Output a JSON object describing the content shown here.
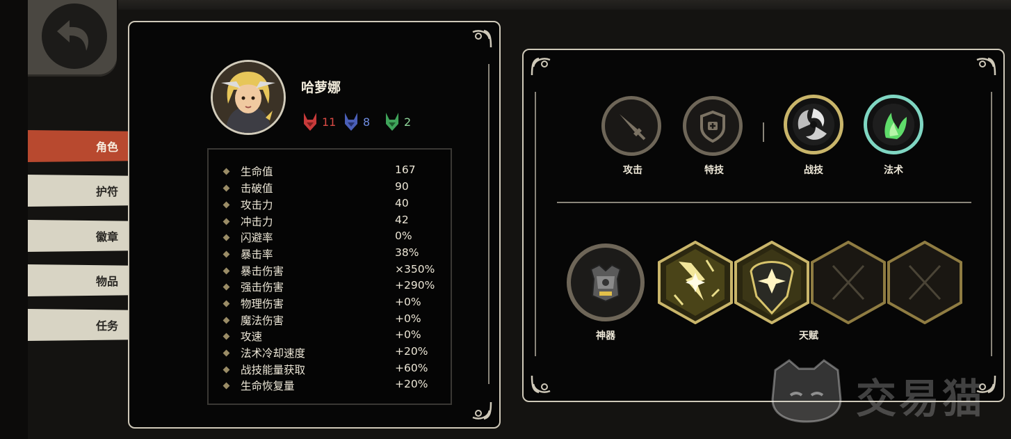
{
  "hero": {
    "name": "哈萝娜",
    "factions": [
      {
        "icon": "red-beast-icon",
        "value": "11",
        "color": "#d94a44"
      },
      {
        "icon": "blue-beast-icon",
        "value": "8",
        "color": "#6f8ce0"
      },
      {
        "icon": "green-beast-icon",
        "value": "2",
        "color": "#6fcf7a"
      }
    ]
  },
  "tabs": [
    {
      "label": "角色",
      "active": true
    },
    {
      "label": "护符",
      "active": false
    },
    {
      "label": "徽章",
      "active": false
    },
    {
      "label": "物品",
      "active": false
    },
    {
      "label": "任务",
      "active": false
    }
  ],
  "stats": [
    {
      "name": "生命值",
      "value": "167"
    },
    {
      "name": "击破值",
      "value": "90"
    },
    {
      "name": "攻击力",
      "value": "40"
    },
    {
      "name": "冲击力",
      "value": "42"
    },
    {
      "name": "闪避率",
      "value": "0%"
    },
    {
      "name": "暴击率",
      "value": "38%"
    },
    {
      "name": "暴击伤害",
      "value": "×350%"
    },
    {
      "name": "强击伤害",
      "value": "+290%"
    },
    {
      "name": "物理伤害",
      "value": "+0%"
    },
    {
      "name": "魔法伤害",
      "value": "+0%"
    },
    {
      "name": "攻速",
      "value": "+0%"
    },
    {
      "name": "法术冷却速度",
      "value": "+20%"
    },
    {
      "name": "战技能量获取",
      "value": "+60%"
    },
    {
      "name": "生命恢复量",
      "value": "+20%"
    }
  ],
  "skills": [
    {
      "label": "攻击",
      "icon": "sword-icon"
    },
    {
      "label": "特技",
      "icon": "shield-cross-icon"
    },
    {
      "label": "战技",
      "icon": "swirl-blades-icon"
    },
    {
      "label": "法术",
      "icon": "green-flame-icon"
    }
  ],
  "equipment": {
    "artifact_label": "神器",
    "talent_label": "天赋"
  },
  "watermark_text": "交易猫",
  "colors": {
    "accent_red": "#b8492f",
    "tab_bg": "#d8d4c4",
    "gold": "#c9b56a",
    "teal": "#7fd6c2"
  }
}
